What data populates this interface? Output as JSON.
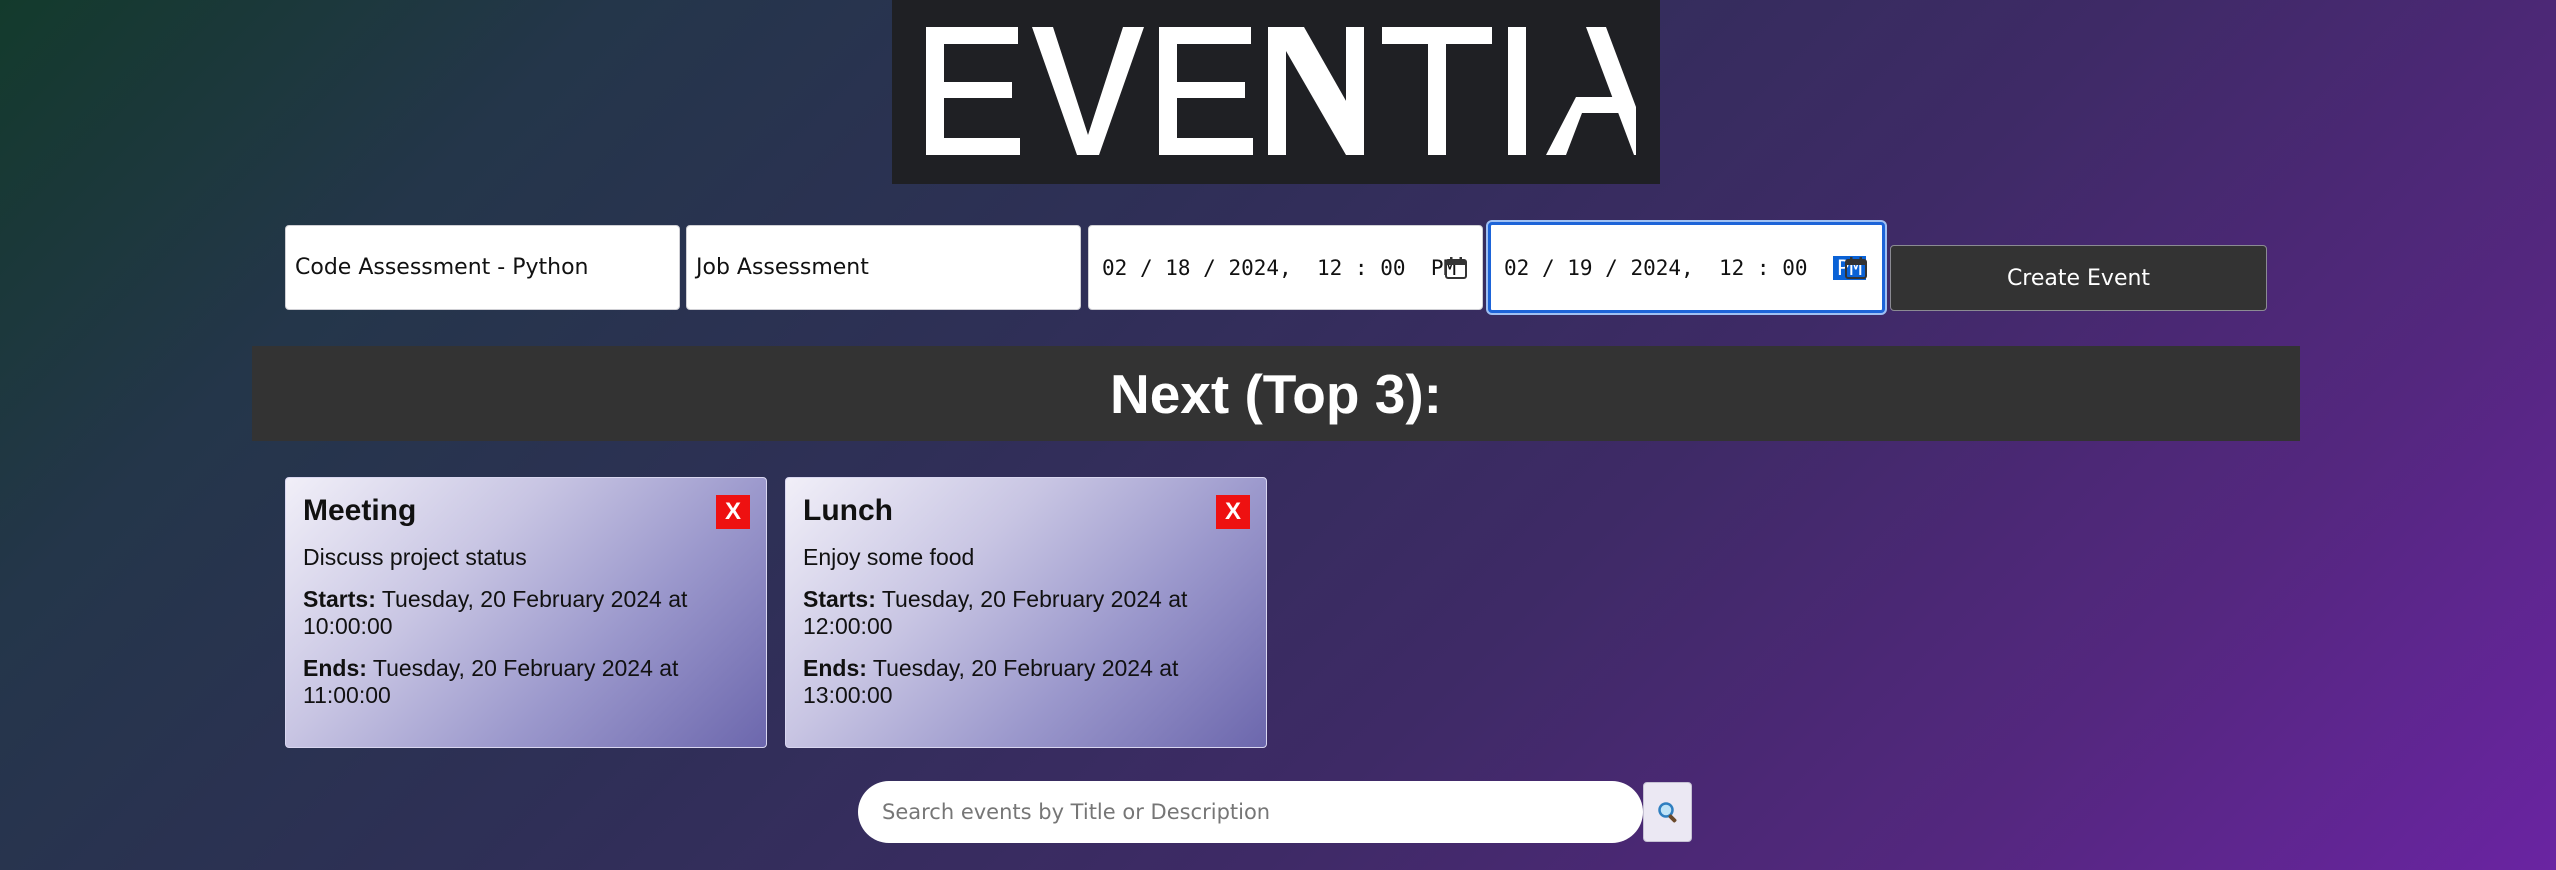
{
  "logo": {
    "text": "EVENTIA"
  },
  "form": {
    "title_value": "Code Assessment - Python",
    "description_value": "Job Assessment",
    "start": {
      "month": "02",
      "day": "18",
      "year": "2024",
      "hour": "12",
      "minute": "00",
      "ampm": "PM"
    },
    "end": {
      "month": "02",
      "day": "19",
      "year": "2024",
      "hour": "12",
      "minute": "00",
      "ampm": "PM"
    },
    "create_label": "Create Event"
  },
  "section": {
    "title": "Next (Top 3):"
  },
  "events": [
    {
      "title": "Meeting",
      "close": "X",
      "description": "Discuss project status",
      "starts_label": "Starts:",
      "starts": "Tuesday, 20 February 2024 at 10:00:00",
      "ends_label": "Ends:",
      "ends": "Tuesday, 20 February 2024 at 11:00:00"
    },
    {
      "title": "Lunch",
      "close": "X",
      "description": "Enjoy some food",
      "starts_label": "Starts:",
      "starts": "Tuesday, 20 February 2024 at 12:00:00",
      "ends_label": "Ends:",
      "ends": "Tuesday, 20 February 2024 at 13:00:00"
    }
  ],
  "search": {
    "placeholder": "Search events by Title or Description",
    "icon": "search-icon"
  },
  "colors": {
    "accent_focus": "#1d64d8",
    "delete_red": "#ee1111",
    "bar_dark": "#333333"
  }
}
